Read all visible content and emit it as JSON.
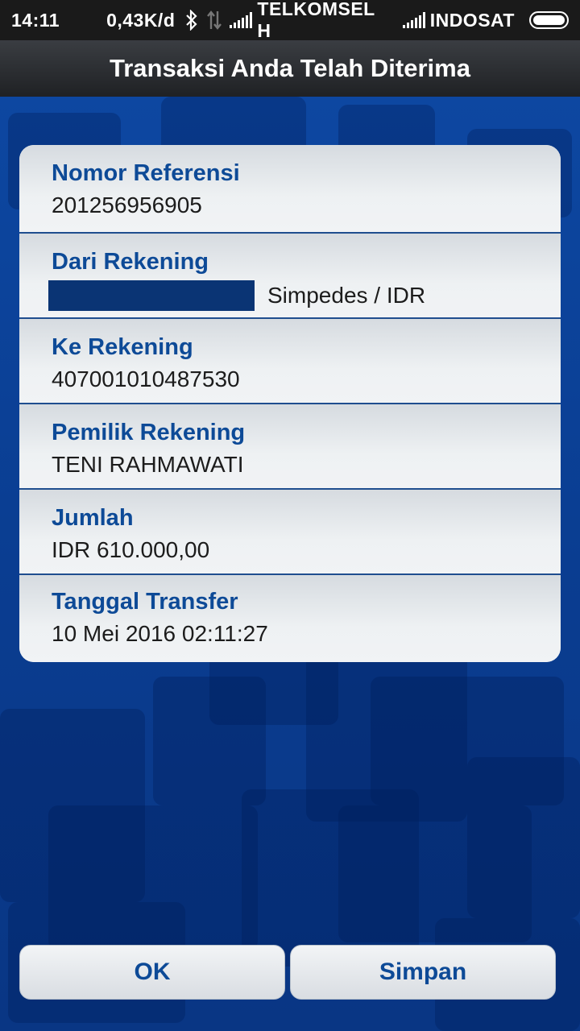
{
  "status_bar": {
    "time": "14:11",
    "speed": "0,43K/d",
    "carrier1": "TELKOMSEL H",
    "carrier2": "INDOSAT"
  },
  "header": {
    "title": "Transaksi Anda Telah Diterima"
  },
  "details": {
    "ref_label": "Nomor Referensi",
    "ref_value": "201256956905",
    "from_label": "Dari Rekening",
    "from_value": "Simpedes / IDR",
    "to_label": "Ke Rekening",
    "to_value": "407001010487530",
    "owner_label": "Pemilik Rekening",
    "owner_value": "TENI RAHMAWATI",
    "amount_label": "Jumlah",
    "amount_value": "IDR 610.000,00",
    "date_label": "Tanggal Transfer",
    "date_value": "10 Mei 2016 02:11:27"
  },
  "actions": {
    "ok_label": "OK",
    "save_label": "Simpan"
  }
}
